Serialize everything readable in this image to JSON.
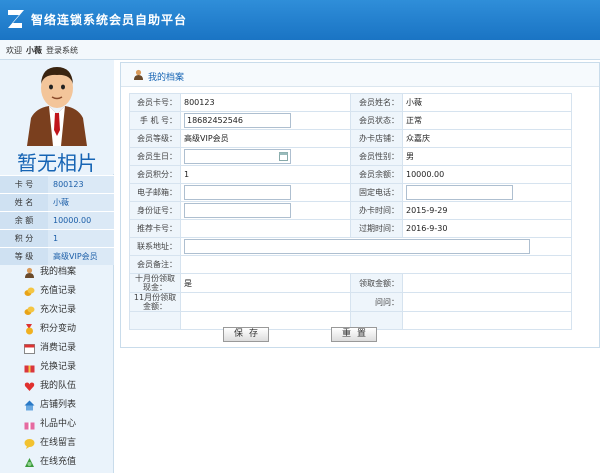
{
  "app": {
    "title": "智络连锁系统会员自助平台"
  },
  "welcome": {
    "prefix": "欢迎",
    "user": "小薇",
    "login": "登录系统"
  },
  "profile": {
    "no_photo": "暂无相片",
    "rows": [
      {
        "key": "卡  号",
        "value": "800123"
      },
      {
        "key": "姓  名",
        "value": "小薇"
      },
      {
        "key": "余  额",
        "value": "10000.00"
      },
      {
        "key": "积  分",
        "value": "1"
      },
      {
        "key": "等  级",
        "value": "高级VIP会员"
      }
    ]
  },
  "menu": [
    {
      "label": "我的档案",
      "icon": "user-icon"
    },
    {
      "label": "充值记录",
      "icon": "coins-icon"
    },
    {
      "label": "充次记录",
      "icon": "coins-icon"
    },
    {
      "label": "积分变动",
      "icon": "medal-icon"
    },
    {
      "label": "消费记录",
      "icon": "calendar-icon"
    },
    {
      "label": "兑换记录",
      "icon": "gift-icon"
    },
    {
      "label": "我的队伍",
      "icon": "heart-icon"
    },
    {
      "label": "店铺列表",
      "icon": "house-icon"
    },
    {
      "label": "礼品中心",
      "icon": "gift-icon"
    },
    {
      "label": "在线留言",
      "icon": "chat-icon"
    },
    {
      "label": "在线充值",
      "icon": "money-icon"
    }
  ],
  "panel": {
    "title": "我的档案"
  },
  "form": {
    "card_no_label": "会员卡号：",
    "card_no": "800123",
    "name_label": "会员姓名：",
    "name": "小薇",
    "phone_label": "手 机 号：",
    "phone": "18682452546",
    "status_label": "会员状态：",
    "status": "正常",
    "level_label": "会员等级：",
    "level": "高级VIP会员",
    "store_label": "办卡店铺：",
    "store": "众嘉庆",
    "birthday_label": "会员生日：",
    "birthday": "",
    "gender_label": "会员性别：",
    "gender": "男",
    "points_label": "会员积分：",
    "points": "1",
    "balance_label": "会员余额：",
    "balance": "10000.00",
    "email_label": "电子邮箱：",
    "email": "",
    "tel_label": "固定电话：",
    "tel": "",
    "id_label": "身份证号：",
    "id": "",
    "open_time_label": "办卡时间：",
    "open_time": "2015-9-29",
    "referrer_label": "推荐卡号：",
    "referrer": "",
    "expire_label": "过期时间：",
    "expire": "2016-9-30",
    "address_label": "联系地址：",
    "address": "",
    "remark_label": "会员备注：",
    "remark": "",
    "oct_label": "十月份领取现金：",
    "oct": "是",
    "claim_amount_label": "领取金额：",
    "claim_amount": "",
    "nov_label": "11月份领取金额：",
    "nov": "",
    "ask_label": "问问：",
    "ask": ""
  },
  "buttons": {
    "save": "保存",
    "reset": "重置"
  },
  "colors": {
    "header": "#1a74c4",
    "accent": "#1664b4",
    "sidebar": "#eaf3fb"
  }
}
